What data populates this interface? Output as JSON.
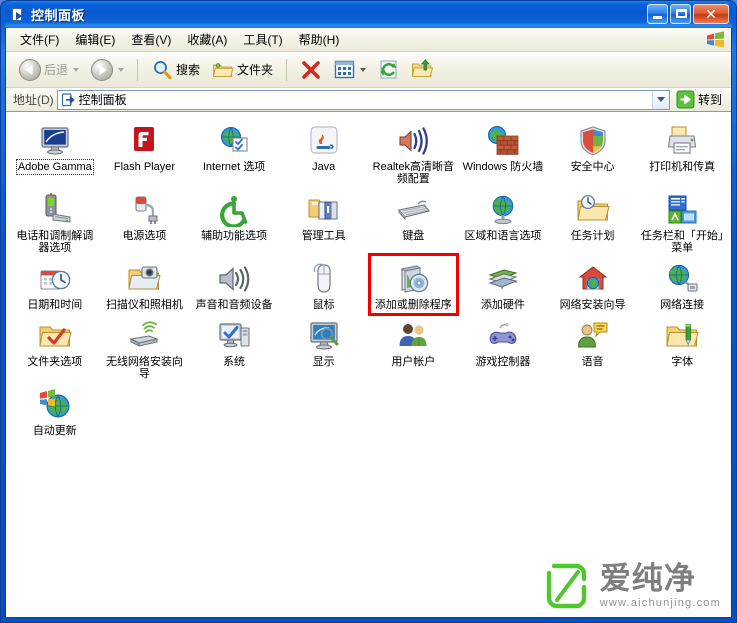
{
  "window": {
    "title": "控制面板",
    "title_icon": "control-panel-icon",
    "buttons": {
      "minimize": "最小化",
      "maximize": "最大化",
      "close": "关闭"
    }
  },
  "menubar": {
    "items": [
      {
        "label": "文件(F)",
        "name": "menu-file"
      },
      {
        "label": "编辑(E)",
        "name": "menu-edit"
      },
      {
        "label": "查看(V)",
        "name": "menu-view"
      },
      {
        "label": "收藏(A)",
        "name": "menu-favorites"
      },
      {
        "label": "工具(T)",
        "name": "menu-tools"
      },
      {
        "label": "帮助(H)",
        "name": "menu-help"
      }
    ],
    "brand_icon": "windows-flag-icon"
  },
  "toolbar": {
    "back_label": "后退",
    "back_enabled": false,
    "forward_label": "",
    "forward_enabled": false,
    "search_label": "搜索",
    "folders_label": "文件夹",
    "delete_icon": "delete-x-icon",
    "views_icon": "views-icon",
    "refresh_icon": "refresh-icon",
    "up_icon": "folder-up-icon"
  },
  "addressbar": {
    "label": "地址(D)",
    "value": "控制面板",
    "icon": "control-panel-icon",
    "dropdown_icon": "chevron-down-icon",
    "go_label": "转到",
    "go_icon": "green-arrow-icon"
  },
  "content": {
    "highlight": {
      "item_label": "添加或删除程序",
      "color": "#f20000"
    },
    "focused_item": "Adobe Gamma",
    "items": [
      {
        "label": "Adobe Gamma",
        "icon": "adobe-gamma-icon",
        "focused": true
      },
      {
        "label": "Flash Player",
        "icon": "flash-player-icon"
      },
      {
        "label": "Internet 选项",
        "icon": "internet-options-icon"
      },
      {
        "label": "Java",
        "icon": "java-icon"
      },
      {
        "label": "Realtek高清晰音频配置",
        "icon": "realtek-audio-icon"
      },
      {
        "label": "Windows 防火墙",
        "icon": "windows-firewall-icon"
      },
      {
        "label": "安全中心",
        "icon": "security-center-icon"
      },
      {
        "label": "打印机和传真",
        "icon": "printers-faxes-icon"
      },
      {
        "label": "电话和调制解调器选项",
        "icon": "phone-modem-icon"
      },
      {
        "label": "电源选项",
        "icon": "power-options-icon"
      },
      {
        "label": "辅助功能选项",
        "icon": "accessibility-icon"
      },
      {
        "label": "管理工具",
        "icon": "administrative-tools-icon"
      },
      {
        "label": "键盘",
        "icon": "keyboard-icon"
      },
      {
        "label": "区域和语言选项",
        "icon": "regional-language-icon"
      },
      {
        "label": "任务计划",
        "icon": "scheduled-tasks-icon"
      },
      {
        "label": "任务栏和「开始」菜单",
        "icon": "taskbar-startmenu-icon"
      },
      {
        "label": "日期和时间",
        "icon": "date-time-icon"
      },
      {
        "label": "扫描仪和照相机",
        "icon": "scanners-cameras-icon"
      },
      {
        "label": "声音和音频设备",
        "icon": "sounds-audio-icon"
      },
      {
        "label": "鼠标",
        "icon": "mouse-icon"
      },
      {
        "label": "添加或删除程序",
        "icon": "add-remove-programs-icon",
        "highlighted": true
      },
      {
        "label": "添加硬件",
        "icon": "add-hardware-icon"
      },
      {
        "label": "网络安装向导",
        "icon": "network-setup-wizard-icon"
      },
      {
        "label": "网络连接",
        "icon": "network-connections-icon"
      },
      {
        "label": "文件夹选项",
        "icon": "folder-options-icon"
      },
      {
        "label": "无线网络安装向导",
        "icon": "wireless-network-wizard-icon"
      },
      {
        "label": "系统",
        "icon": "system-icon"
      },
      {
        "label": "显示",
        "icon": "display-icon"
      },
      {
        "label": "用户帐户",
        "icon": "user-accounts-icon"
      },
      {
        "label": "游戏控制器",
        "icon": "game-controllers-icon"
      },
      {
        "label": "语音",
        "icon": "speech-icon"
      },
      {
        "label": "字体",
        "icon": "fonts-icon"
      },
      {
        "label": "自动更新",
        "icon": "automatic-updates-icon"
      }
    ]
  },
  "watermark": {
    "brand_cn": "爱纯净",
    "url": "www.aichunjing.com",
    "logo_color": "#4bc628",
    "text_color": "#7b7b7b"
  }
}
